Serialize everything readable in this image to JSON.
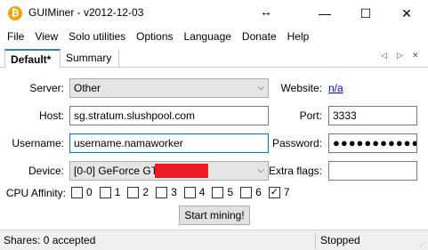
{
  "window": {
    "title": "GUIMiner - v2012-12-03",
    "icon_glyph": "₿"
  },
  "titlebar": {
    "resize_glyph": "↔",
    "minimize": "—",
    "maximize": "☐",
    "close": "✕"
  },
  "menu": [
    "File",
    "View",
    "Solo utilities",
    "Options",
    "Language",
    "Donate",
    "Help"
  ],
  "tabs": {
    "active": "Default*",
    "inactive": "Summary",
    "nav": [
      "◁",
      "▷",
      "✕"
    ]
  },
  "form": {
    "server_label": "Server:",
    "server_value": "Other",
    "website_label": "Website:",
    "website_value": "n/a",
    "host_label": "Host:",
    "host_value": "sg.stratum.slushpool.com",
    "port_label": "Port:",
    "port_value": "3333",
    "username_label": "Username:",
    "username_value": "username.namaworker",
    "password_label": "Password:",
    "password_value": "●●●●●●●●●●●",
    "device_label": "Device:",
    "device_value": "[0-0] GeForce GTX",
    "extra_flags_label": "Extra flags:",
    "extra_flags_value": "",
    "cpu_affinity_label": "CPU Affinity:",
    "cpu_affinity": [
      {
        "label": "0",
        "checked": false
      },
      {
        "label": "1",
        "checked": false
      },
      {
        "label": "2",
        "checked": false
      },
      {
        "label": "3",
        "checked": false
      },
      {
        "label": "4",
        "checked": false
      },
      {
        "label": "5",
        "checked": false
      },
      {
        "label": "6",
        "checked": false
      },
      {
        "label": "7",
        "checked": true
      }
    ],
    "start_button": "Start mining!"
  },
  "status": {
    "shares": "Shares: 0 accepted",
    "state": "Stopped"
  },
  "colors": {
    "redaction": "#ed1c24",
    "focus": "#0078d7",
    "link": "#0000ee"
  }
}
